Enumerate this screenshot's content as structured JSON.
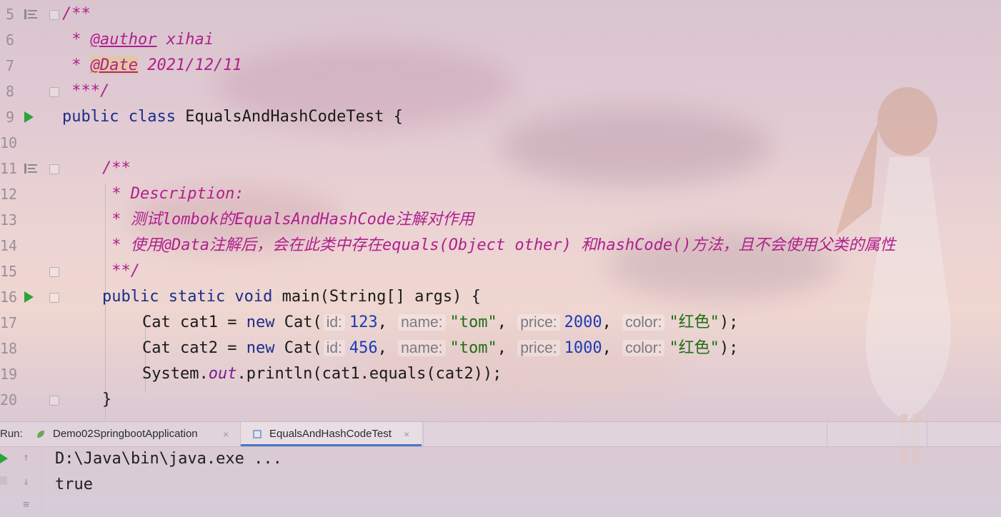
{
  "editor": {
    "line_numbers": [
      "5",
      "6",
      "7",
      "8",
      "9",
      "10",
      "11",
      "12",
      "13",
      "14",
      "15",
      "16",
      "17",
      "18",
      "19",
      "20"
    ],
    "lines": {
      "l5": "/**",
      "l6_tag": "@author",
      "l6_val": " xihai",
      "l7_tag": "@Date",
      "l7_val": " 2021/12/11",
      "l8": " ***/",
      "l9_kw": "public class",
      "l9_name": " EqualsAndHashCodeTest {",
      "l11": "/**",
      "l12": " * Description:",
      "l13": " * 测试lombok的EqualsAndHashCode注解对作用",
      "l14": " * 使用@Data注解后，会在此类中存在equals(Object other) 和hashCode()方法，且不会使用父类的属性",
      "l15": " **/",
      "l16_kw": "public static void",
      "l16_rest": " main(String[] args) {",
      "l17": {
        "decl": "Cat cat1 = ",
        "new": "new",
        "ctor": " Cat(",
        "hint_id": "id:",
        "id": "123",
        "hint_name": "name:",
        "name": "\"tom\"",
        "hint_price": "price:",
        "price": "2000",
        "hint_color": "color:",
        "color": "\"红色\"",
        "end": ");"
      },
      "l18": {
        "decl": "Cat cat2 = ",
        "new": "new",
        "ctor": " Cat(",
        "hint_id": "id:",
        "id": "456",
        "hint_name": "name:",
        "name": "\"tom\"",
        "hint_price": "price:",
        "price": "1000",
        "hint_color": "color:",
        "color": "\"红色\"",
        "end": ");"
      },
      "l19_a": "System.",
      "l19_field": "out",
      "l19_b": ".println(cat1.equals(cat2));",
      "l20": "}"
    }
  },
  "run_panel": {
    "label": "Run:",
    "tabs": [
      {
        "label": "Demo02SpringbootApplication",
        "close": "×"
      },
      {
        "label": "EqualsAndHashCodeTest",
        "close": "×"
      }
    ],
    "output": [
      "D:\\Java\\bin\\java.exe ...",
      "true"
    ]
  },
  "colors": {
    "comment": "#b0208e",
    "keyword": "#1a2d8a",
    "string": "#1d6e14",
    "number": "#1a3ab8",
    "run_icon": "#2aa53b",
    "active_tab": "#4a78c2"
  },
  "icons": [
    "run-gutter-icon",
    "fold-icon",
    "doc-lines-icon",
    "rerun-icon",
    "stop-icon",
    "scroll-up-icon",
    "scroll-down-icon",
    "soft-wrap-icon"
  ]
}
